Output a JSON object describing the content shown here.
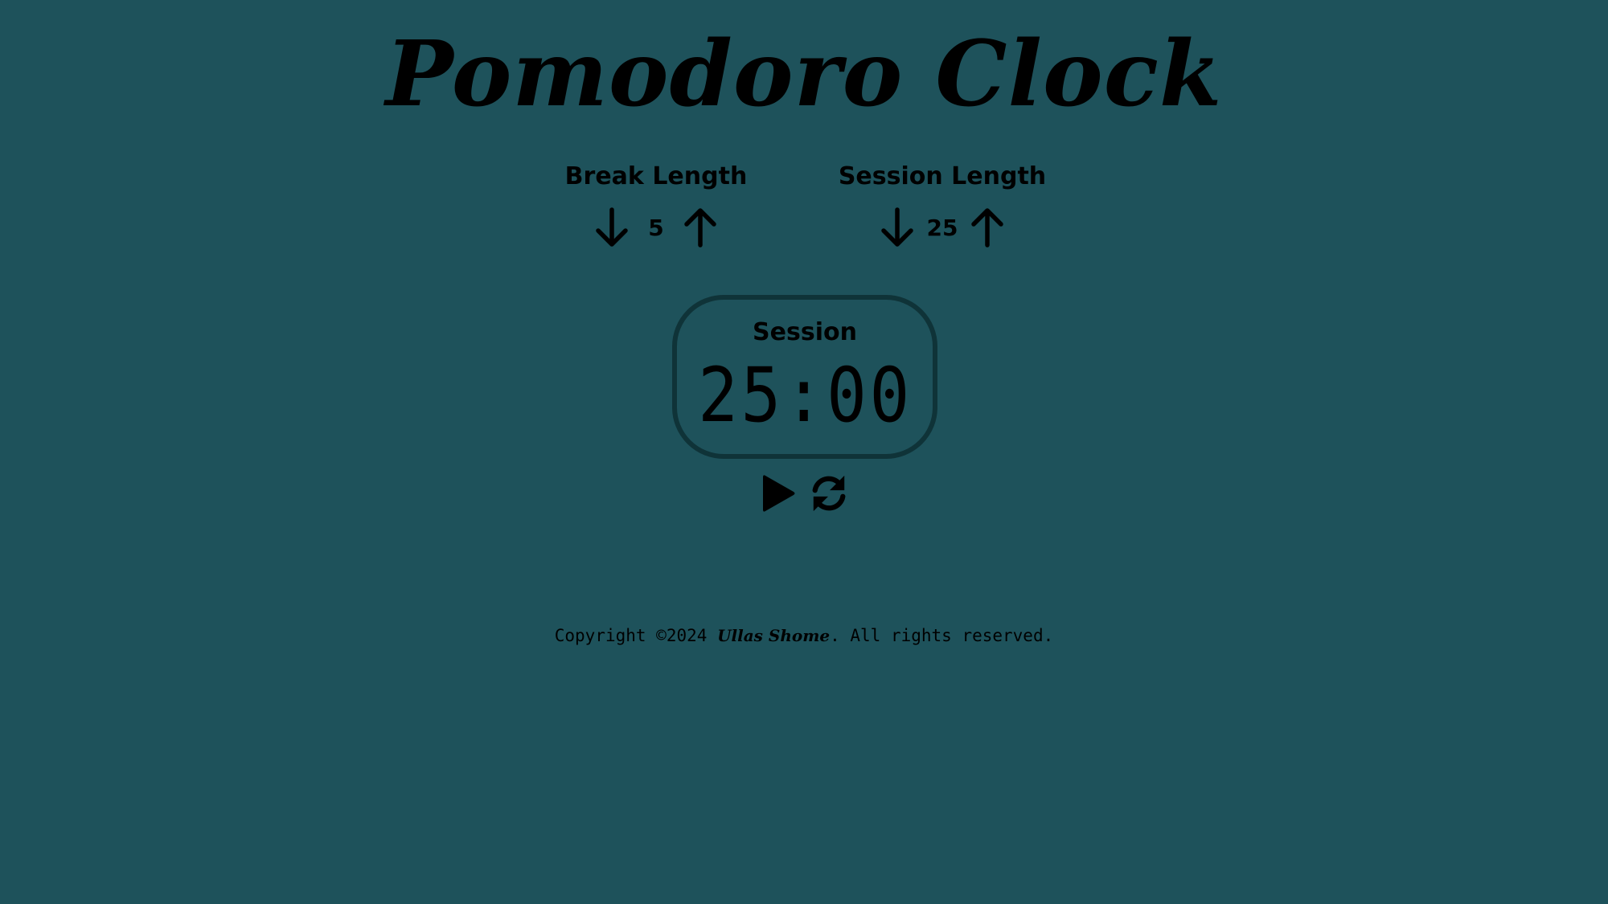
{
  "title": "Pomodoro Clock",
  "break": {
    "label": "Break Length",
    "value": "5",
    "decrement_icon": "arrow-down-icon",
    "increment_icon": "arrow-up-icon"
  },
  "session": {
    "label": "Session Length",
    "value": "25",
    "decrement_icon": "arrow-down-icon",
    "increment_icon": "arrow-up-icon"
  },
  "timer": {
    "label": "Session",
    "time": "25:00"
  },
  "controls": {
    "play_icon": "play-icon",
    "reset_icon": "refresh-icon"
  },
  "footer": {
    "prefix": "Copyright ©2024",
    "author": "Ullas Shome",
    "suffix": ". All rights reserved."
  },
  "colors": {
    "background": "#1e525b",
    "timer_border": "#0f3338",
    "text": "#000000"
  }
}
